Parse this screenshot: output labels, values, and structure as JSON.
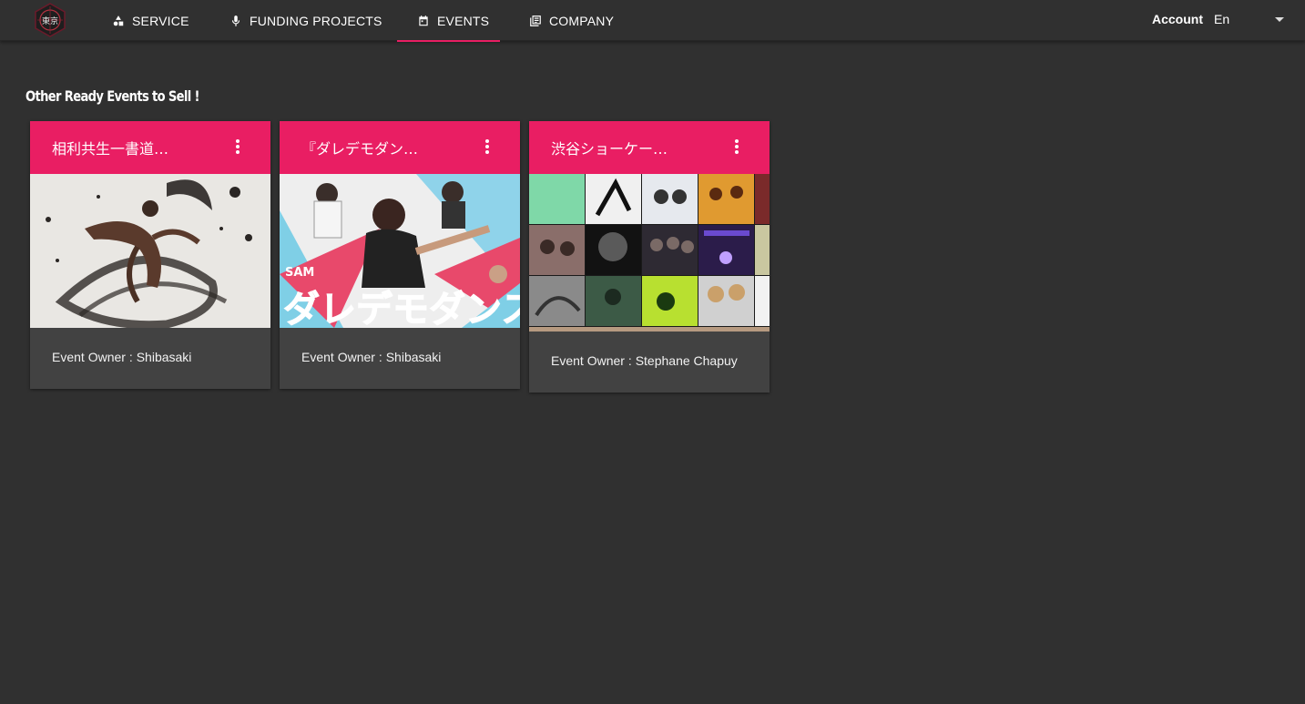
{
  "nav": {
    "items": [
      {
        "label": "SERVICE",
        "icon": "shapes-icon"
      },
      {
        "label": "FUNDING PROJECTS",
        "icon": "microphone-icon"
      },
      {
        "label": "EVENTS",
        "icon": "calendar-icon",
        "active": true
      },
      {
        "label": "COMPANY",
        "icon": "library-books-icon"
      }
    ],
    "account_label": "Account",
    "language": "En",
    "accent_color": "#e91e63"
  },
  "section": {
    "title": "Other Ready Events to Sell !"
  },
  "events": [
    {
      "title": "相利共生一書道…",
      "owner_label": "Event Owner :",
      "owner": "Shibasaki",
      "image": "ink-calligraphy-dancer"
    },
    {
      "title": "『ダレデモダン…",
      "owner_label": "Event Owner :",
      "owner": "Shibasaki",
      "image": "dance-poster"
    },
    {
      "title": "渋谷ショーケー…",
      "owner_label": "Event Owner :",
      "owner": "Stephane Chapuy",
      "image": "artist-photo-grid"
    }
  ],
  "colors": {
    "background": "#303030",
    "card": "#424242",
    "header": "#e91e63"
  }
}
